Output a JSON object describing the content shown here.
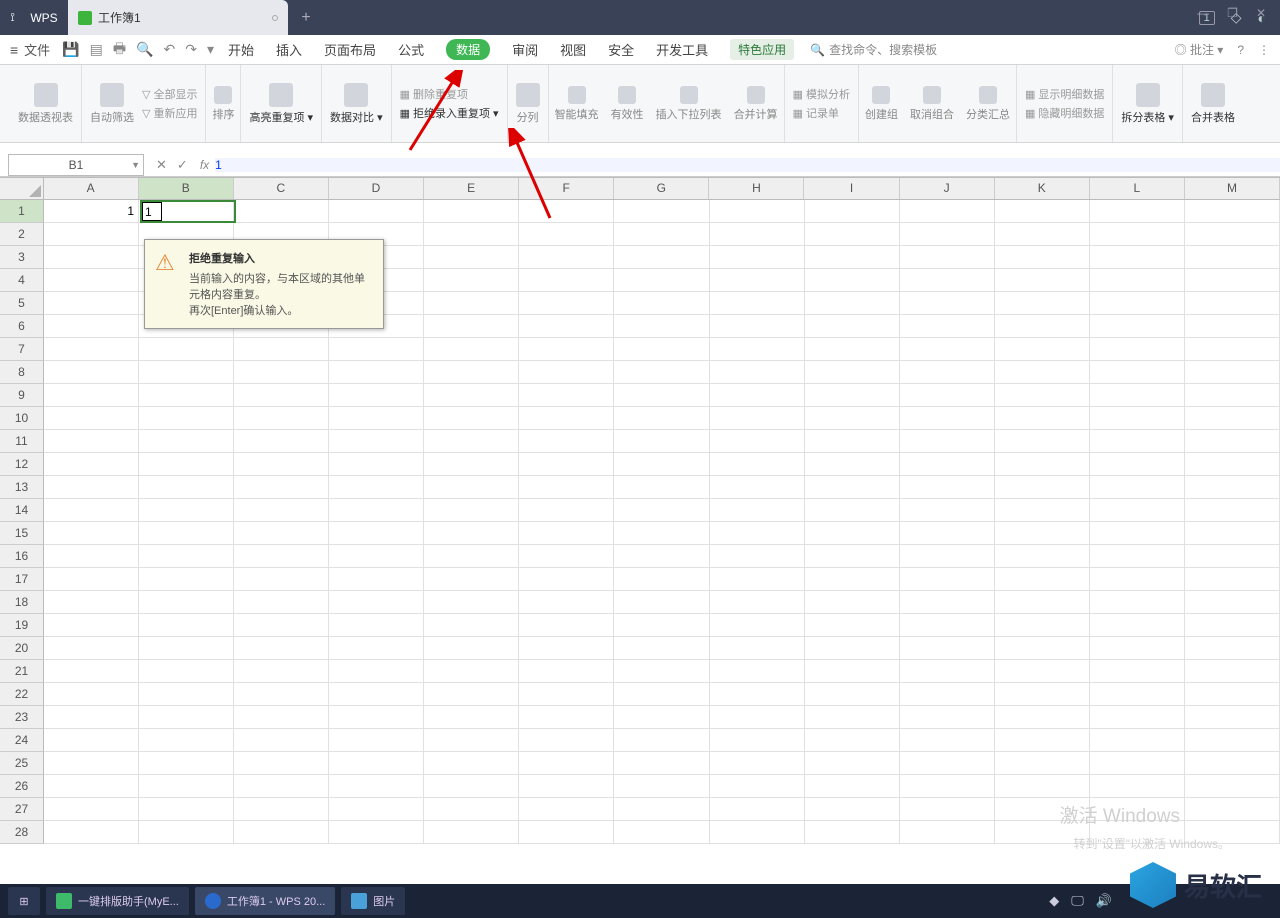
{
  "titlebar": {
    "app": "WPS",
    "doc": "工作簿1",
    "badge": "1",
    "plus": "+"
  },
  "wincontrols": {
    "min": "—",
    "max": "❐",
    "close": "✕"
  },
  "menu": {
    "file": "文件",
    "tabs": [
      "开始",
      "插入",
      "页面布局",
      "公式",
      "数据",
      "审阅",
      "视图",
      "安全",
      "开发工具",
      "特色应用"
    ],
    "active_index": 4,
    "special_index": 9,
    "search_placeholder": "查找命令、搜索模板",
    "right_remark": "◎ 批注 ▾",
    "help": "?",
    "more": "⋮"
  },
  "ribbon": {
    "g1": "数据透视表",
    "g2a": "自动筛选",
    "g2b_1": "全部显示",
    "g2b_2": "重新应用",
    "g3": "排序",
    "g4": "高亮重复项",
    "g5": "数据对比",
    "g6a": "删除重复项",
    "g6b": "拒绝录入重复项",
    "g7a": "分列",
    "g7b": "智能填充",
    "g7c": "有效性",
    "g7d": "插入下拉列表",
    "g7e": "合并计算",
    "g8a": "模拟分析",
    "g8b": "记录单",
    "g9a": "创建组",
    "g9b": "取消组合",
    "g9c": "分类汇总",
    "g10a": "显示明细数据",
    "g10b": "隐藏明细数据",
    "g11": "拆分表格",
    "g12": "合并表格"
  },
  "fbar": {
    "name": "B1",
    "cancel": "✕",
    "ok": "✓",
    "fx": "fx",
    "value": "1"
  },
  "grid": {
    "cols": [
      "A",
      "B",
      "C",
      "D",
      "E",
      "F",
      "G",
      "H",
      "I",
      "J",
      "K",
      "L",
      "M"
    ],
    "rows": [
      1,
      2,
      3,
      4,
      5,
      6,
      7,
      8,
      9,
      10,
      11,
      12,
      13,
      14,
      15,
      16,
      17,
      18,
      19,
      20,
      21,
      22,
      23,
      24,
      25,
      26,
      27,
      28
    ],
    "A1": "1",
    "B1_editing": "1"
  },
  "tooltip": {
    "title": "拒绝重复输入",
    "line1": "当前输入的内容，与本区域的其他单元格内容重复。",
    "line2": "再次[Enter]确认输入。"
  },
  "watermark": {
    "l1": "激活 Windows",
    "l2": "转到\"设置\"以激活 Windows。"
  },
  "logo": "易软汇",
  "taskbar": {
    "t1": "一键排版助手(MyE...",
    "t2": "工作簿1 - WPS 20...",
    "t3": "图片"
  }
}
